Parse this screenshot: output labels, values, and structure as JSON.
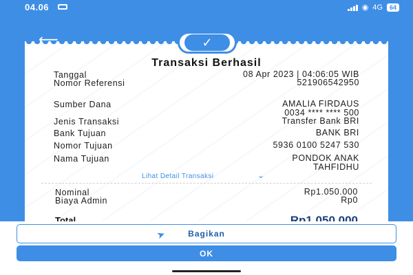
{
  "status": {
    "time": "04.06",
    "network": "4G",
    "battery": "64"
  },
  "receipt": {
    "title": "Transaksi Berhasil",
    "rows": {
      "tanggal": {
        "label": "Tanggal",
        "value": "08 Apr 2023 | 04:06:05 WIB"
      },
      "referensi": {
        "label": "Nomor Referensi",
        "value": "521906542950"
      },
      "sumber": {
        "label": "Sumber Dana",
        "value_line1": "AMALIA FIRDAUS",
        "value_line2": "0034 **** **** 500"
      },
      "jenis": {
        "label": "Jenis Transaksi",
        "value": "Transfer Bank BRI"
      },
      "bank": {
        "label": "Bank Tujuan",
        "value": "BANK BRI"
      },
      "nomor_tujuan": {
        "label": "Nomor Tujuan",
        "value": "5936 0100 5247 530"
      },
      "nama_tujuan": {
        "label": "Nama Tujuan",
        "value_line1": "PONDOK ANAK",
        "value_line2": "TAHFIDHU"
      },
      "nominal": {
        "label": "Nominal",
        "value": "Rp1.050.000"
      },
      "biaya": {
        "label": "Biaya Admin",
        "value": "Rp0"
      }
    },
    "detail_link": "Lihat Detail Transaksi",
    "total": {
      "label": "Total",
      "value": "Rp1.050.000"
    }
  },
  "actions": {
    "share_label": "Bagikan",
    "ok_label": "OK"
  },
  "colors": {
    "primary": "#3e8ee6",
    "text": "#1c1c1c",
    "total": "#1a3f7a"
  },
  "icons": {
    "back": "arrow-left-icon",
    "check": "check-icon",
    "share": "send-icon",
    "chevron": "chevron-down-icon"
  }
}
